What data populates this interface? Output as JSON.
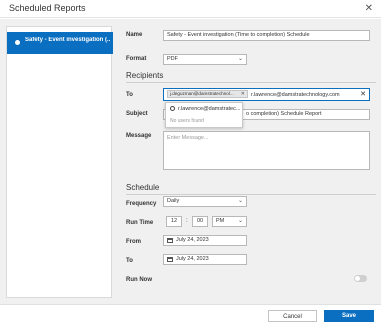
{
  "window": {
    "title": "Scheduled Reports",
    "close_glyph": "✕"
  },
  "sidebar": {
    "items": [
      {
        "label": "Safety - Event investigation (..."
      }
    ]
  },
  "form": {
    "name": {
      "label": "Name",
      "value": "Safety - Event investigation (Time to completion) Schedule"
    },
    "format": {
      "label": "Format",
      "value": "PDF"
    },
    "recipients_title": "Recipients",
    "to": {
      "label": "To",
      "chip": "j.deguzman@damstratechnol...",
      "chip_remove": "✕",
      "typed": "r.lawrence@damstratechnology.com",
      "clear": "✕"
    },
    "suggestions": {
      "item": "r.lawrence@damstratec...",
      "empty": "No users found"
    },
    "subject": {
      "label": "Subject",
      "value": "o completion) Schedule Report"
    },
    "message": {
      "label": "Message",
      "placeholder": "Enter Message..."
    },
    "schedule_title": "Schedule",
    "frequency": {
      "label": "Frequency",
      "value": "Daily"
    },
    "run_time": {
      "label": "Run Time",
      "hour": "12",
      "sep": ":",
      "minute": "00",
      "ampm": "PM"
    },
    "from": {
      "label": "From",
      "value": "July 24, 2023"
    },
    "to_date": {
      "label": "To",
      "value": "July 24, 2023"
    },
    "run_now": {
      "label": "Run Now",
      "on": false
    }
  },
  "footer": {
    "cancel": "Cancel",
    "save": "Save"
  },
  "colors": {
    "accent": "#0b6fc1",
    "panel_bg": "#f0f0f0",
    "border": "#b8b8b8"
  }
}
